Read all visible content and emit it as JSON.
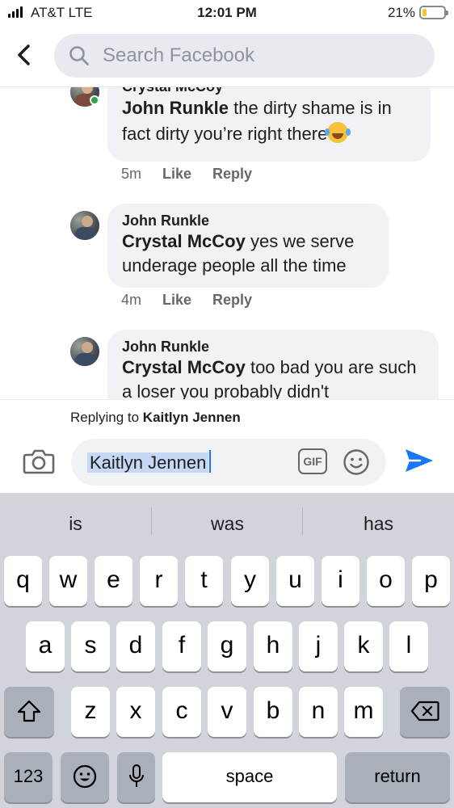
{
  "status_bar": {
    "carrier": "AT&T  LTE",
    "time": "12:01 PM",
    "battery_percent_text": "21%",
    "battery_level": 0.21
  },
  "header": {
    "search_placeholder": "Search Facebook"
  },
  "comments": [
    {
      "author": "Crystal McCoy",
      "tag": "John Runkle",
      "text": " the dirty shame is in fact dirty you’re right there",
      "time": "5m",
      "like": "Like",
      "reply": "Reply"
    },
    {
      "author": "John Runkle",
      "tag": "Crystal McCoy",
      "text": " yes we serve underage people all the time",
      "time": "4m",
      "like": "Like",
      "reply": "Reply"
    },
    {
      "author": "John Runkle",
      "tag": "Crystal McCoy",
      "text": " too bad you are such a loser you probably didn't"
    }
  ],
  "reply_bar": {
    "replying_prefix": "Replying to",
    "replying_name": "Kaitlyn Jennen",
    "compose_value": "Kaitlyn Jennen",
    "gif_label": "GIF"
  },
  "keyboard": {
    "suggestions": [
      "is",
      "was",
      "has"
    ],
    "row1": [
      "q",
      "w",
      "e",
      "r",
      "t",
      "y",
      "u",
      "i",
      "o",
      "p"
    ],
    "row2": [
      "a",
      "s",
      "d",
      "f",
      "g",
      "h",
      "j",
      "k",
      "l"
    ],
    "row3": [
      "z",
      "x",
      "c",
      "v",
      "b",
      "n",
      "m"
    ],
    "numbers_label": "123",
    "space_label": "space",
    "return_label": "return"
  },
  "colors": {
    "accent": "#1877f2",
    "bubble": "#f0f2f5",
    "online": "#31a24c",
    "keyboard_bg": "#d1d4da"
  }
}
